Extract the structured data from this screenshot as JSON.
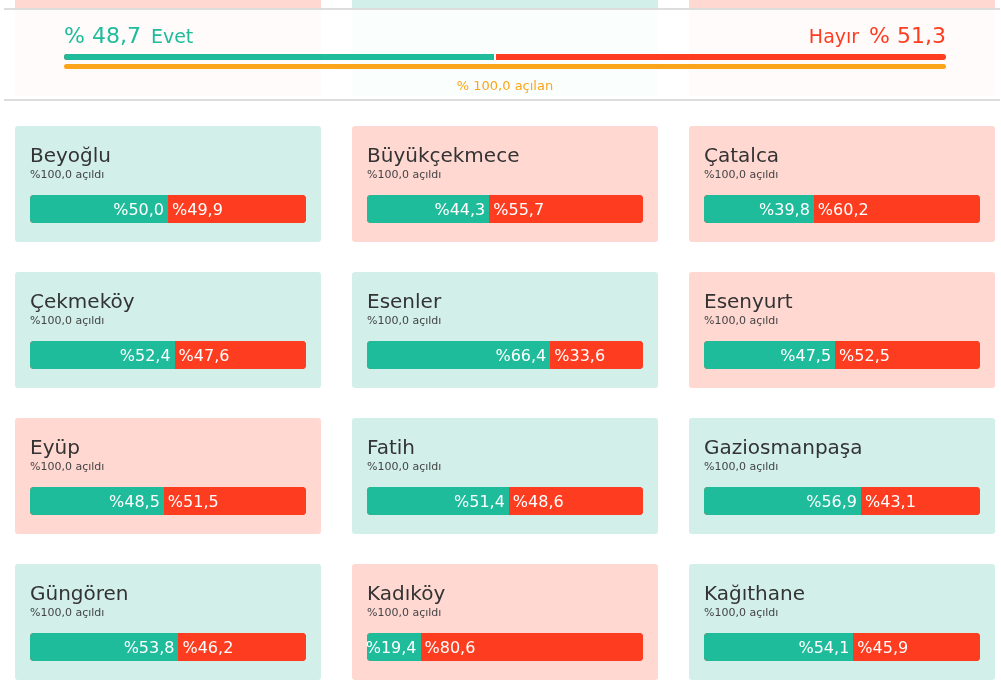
{
  "summary": {
    "yes_value": "% 48,7",
    "yes_label": "Evet",
    "no_label": "Hayır",
    "no_value": "% 51,3",
    "level": 0.487,
    "opened": {
      "level": 1.0,
      "label": "% 100,0 açılan"
    }
  },
  "covered_cards": [
    {
      "color": "#ffd8d2"
    },
    {
      "color": "#d2f0e9"
    },
    {
      "color": "#ffd8d2"
    }
  ],
  "districts": [
    {
      "name": "Beyoğlu",
      "opened": "%100,0 açıldı",
      "yes": "%50,0",
      "no": "%49,9",
      "level": 0.5,
      "color": "#d2f0e9"
    },
    {
      "name": "Büyükçekmece",
      "opened": "%100,0 açıldı",
      "yes": "%44,3",
      "no": "%55,7",
      "level": 0.443,
      "color": "#ffd8d2"
    },
    {
      "name": "Çatalca",
      "opened": "%100,0 açıldı",
      "yes": "%39,8",
      "no": "%60,2",
      "level": 0.398,
      "color": "#ffd8d2"
    },
    {
      "name": "Çekmeköy",
      "opened": "%100,0 açıldı",
      "yes": "%52,4",
      "no": "%47,6",
      "level": 0.524,
      "color": "#d2f0e9"
    },
    {
      "name": "Esenler",
      "opened": "%100,0 açıldı",
      "yes": "%66,4",
      "no": "%33,6",
      "level": 0.664,
      "color": "#d2f0e9"
    },
    {
      "name": "Esenyurt",
      "opened": "%100,0 açıldı",
      "yes": "%47,5",
      "no": "%52,5",
      "level": 0.475,
      "color": "#ffd8d2"
    },
    {
      "name": "Eyüp",
      "opened": "%100,0 açıldı",
      "yes": "%48,5",
      "no": "%51,5",
      "level": 0.485,
      "color": "#ffd8d2"
    },
    {
      "name": "Fatih",
      "opened": "%100,0 açıldı",
      "yes": "%51,4",
      "no": "%48,6",
      "level": 0.514,
      "color": "#d2f0e9"
    },
    {
      "name": "Gaziosmanpaşa",
      "opened": "%100,0 açıldı",
      "yes": "%56,9",
      "no": "%43,1",
      "level": 0.569,
      "color": "#d2f0e9"
    },
    {
      "name": "Güngören",
      "opened": "%100,0 açıldı",
      "yes": "%53,8",
      "no": "%46,2",
      "level": 0.538,
      "color": "#d2f0e9"
    },
    {
      "name": "Kadıköy",
      "opened": "%100,0 açıldı",
      "yes": "%19,4",
      "no": "%80,6",
      "level": 0.194,
      "color": "#ffd8d2"
    },
    {
      "name": "Kağıthane",
      "opened": "%100,0 açıldı",
      "yes": "%54,1",
      "no": "%45,9",
      "level": 0.541,
      "color": "#d2f0e9"
    }
  ]
}
